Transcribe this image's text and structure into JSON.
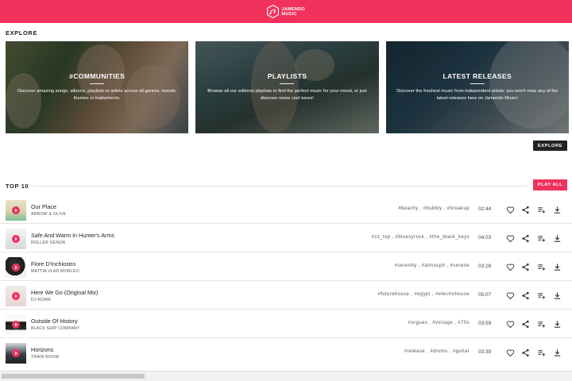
{
  "brand": {
    "name": "JAMENDO MUSIC",
    "color": "#f0325d"
  },
  "explore": {
    "title": "EXPLORE",
    "cards": [
      {
        "title": "#COMMUNITIES",
        "description": "Discover amazing songs, albums, playlists or artists across all genres, moods, themes or instruments."
      },
      {
        "title": "PLAYLISTS",
        "description": "Browse all our editorial playlists to find the perfect music for your mood, or just discover some cool tunes!"
      },
      {
        "title": "LATEST RELEASES",
        "description": "Discover the freshest music from independent artists: you won't miss any of the latest releases here on Jamendo Music!"
      }
    ],
    "button_label": "EXPLORE"
  },
  "top10": {
    "title": "TOP 10",
    "play_all_label": "PLAY ALL",
    "tracks": [
      {
        "title": "Our Place",
        "artist": "ARROW & OLIVE",
        "tags": "#beachy , #bubbly , #breakup",
        "duration": "02:44"
      },
      {
        "title": "Safe And Warm In Hunter's Arms",
        "artist": "ROLLER GENOA",
        "tags": "#zz_top , #bluesyrock , #the_black_keys",
        "duration": "04:03"
      },
      {
        "title": "Fiore D'Inchiostro",
        "artist": "MATTIA VLAD MORLEO",
        "tags": "#serenity , #atmosph , #serene",
        "duration": "03:28"
      },
      {
        "title": "Here We Go (Original Mix)",
        "artist": "DJ ROAM",
        "tags": "#futurehouse , #egypt , #electrohouse",
        "duration": "05:07"
      },
      {
        "title": "Outside Of History",
        "artist": "BLACK SHIP COMPANY",
        "tags": "#orgues , #vintage , #70s",
        "duration": "03:59"
      },
      {
        "title": "Horizons",
        "artist": "TRAIN ROOM",
        "tags": "#release , #drums , #guitar",
        "duration": "03:39"
      }
    ]
  },
  "row_icons": [
    "heart-icon",
    "share-icon",
    "add-to-queue-icon",
    "download-icon"
  ]
}
